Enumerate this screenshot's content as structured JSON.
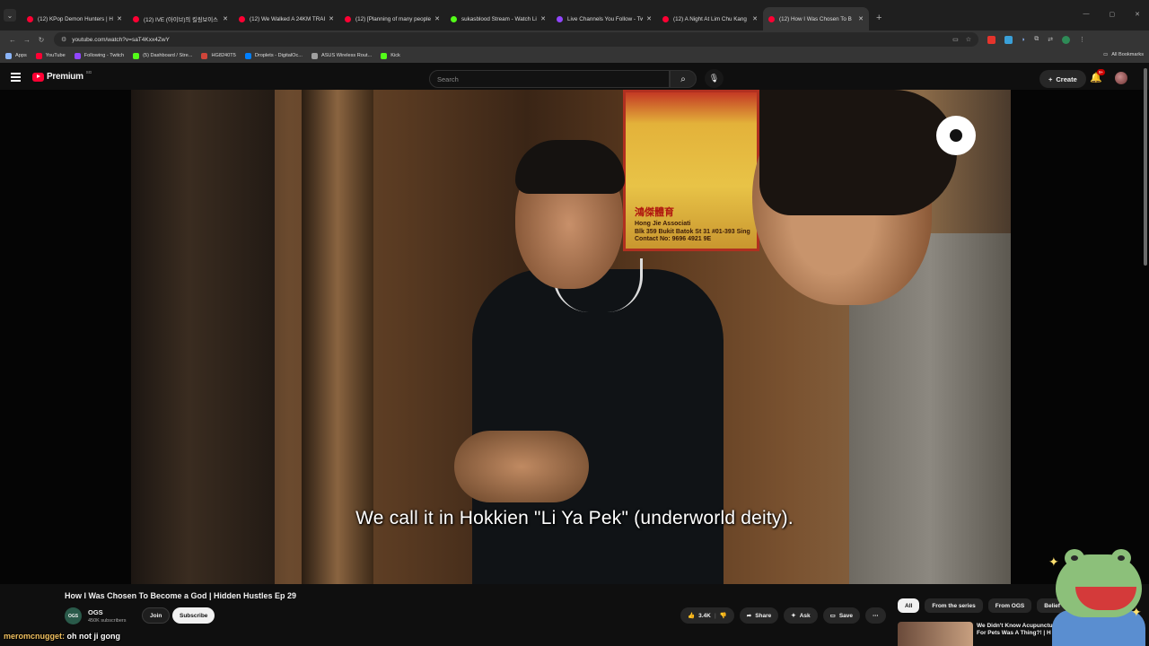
{
  "tabs": [
    {
      "title": "(12) KPop Demon Hunters | Ho",
      "color": "#ff0033",
      "active": false
    },
    {
      "title": "(12) IVE (아이브)의 킬링보이스",
      "color": "#ff0033",
      "active": false
    },
    {
      "title": "(12) We Walked A 24KM TRAIL",
      "color": "#ff0033",
      "active": false
    },
    {
      "title": "(12) [Planning of many people",
      "color": "#ff0033",
      "active": false
    },
    {
      "title": "sukasblood Stream - Watch Liv",
      "color": "#53fc18",
      "active": false
    },
    {
      "title": "Live Channels You Follow - Twit",
      "color": "#9146ff",
      "active": false
    },
    {
      "title": "(12) A Night At Lim Chu Kang C",
      "color": "#ff0033",
      "active": false
    },
    {
      "title": "(12) How I Was Chosen To B",
      "color": "#ff0033",
      "active": true
    }
  ],
  "browser": {
    "url": "youtube.com/watch?v=saT4Kxx4ZwY",
    "bookmarks": [
      {
        "label": "Apps",
        "color": "#8ab4f8"
      },
      {
        "label": "YouTube",
        "color": "#ff0033"
      },
      {
        "label": "Following - Twitch",
        "color": "#9146ff"
      },
      {
        "label": "(5) Dashboard / Stre...",
        "color": "#53fc18"
      },
      {
        "label": "HG8240T5",
        "color": "#d0453a"
      },
      {
        "label": "Droplets - DigitalOc...",
        "color": "#0080ff"
      },
      {
        "label": "ASUS Wireless Rout...",
        "color": "#a0a0a0"
      },
      {
        "label": "Kick",
        "color": "#53fc18"
      }
    ],
    "all_bookmarks": "All Bookmarks"
  },
  "youtube": {
    "logo_text": "Premium",
    "logo_cc": "SG",
    "search_placeholder": "Search",
    "create_label": "Create",
    "notif_count": "9+"
  },
  "video": {
    "subtitle": "We call it in Hokkien \"Li Ya Pek\" (underworld deity).",
    "sign_chinese": "鴻傑體育",
    "sign_lines": [
      "Hong Jie Associati",
      "Blk 359 Bukit Batok St 31 #01-393 Sing",
      "Contact No: 9696 4921 9E"
    ]
  },
  "info": {
    "title": "How I Was Chosen To Become a God | Hidden Hustles Ep 29",
    "channel_avatar": "OGS",
    "channel_name": "OGS",
    "subscribers": "450K subscribers",
    "join_label": "Join",
    "subscribe_label": "Subscribe",
    "like_count": "3.4K",
    "share_label": "Share",
    "ask_label": "Ask",
    "save_label": "Save",
    "chips": [
      "All",
      "From the series",
      "From OGS",
      "Belief"
    ],
    "rec_title": "We Didn't Know Acupuncture For Pets Was A Thing?! | H"
  },
  "chat": {
    "user": "meromcnugget:",
    "message": "oh not ji gong"
  }
}
